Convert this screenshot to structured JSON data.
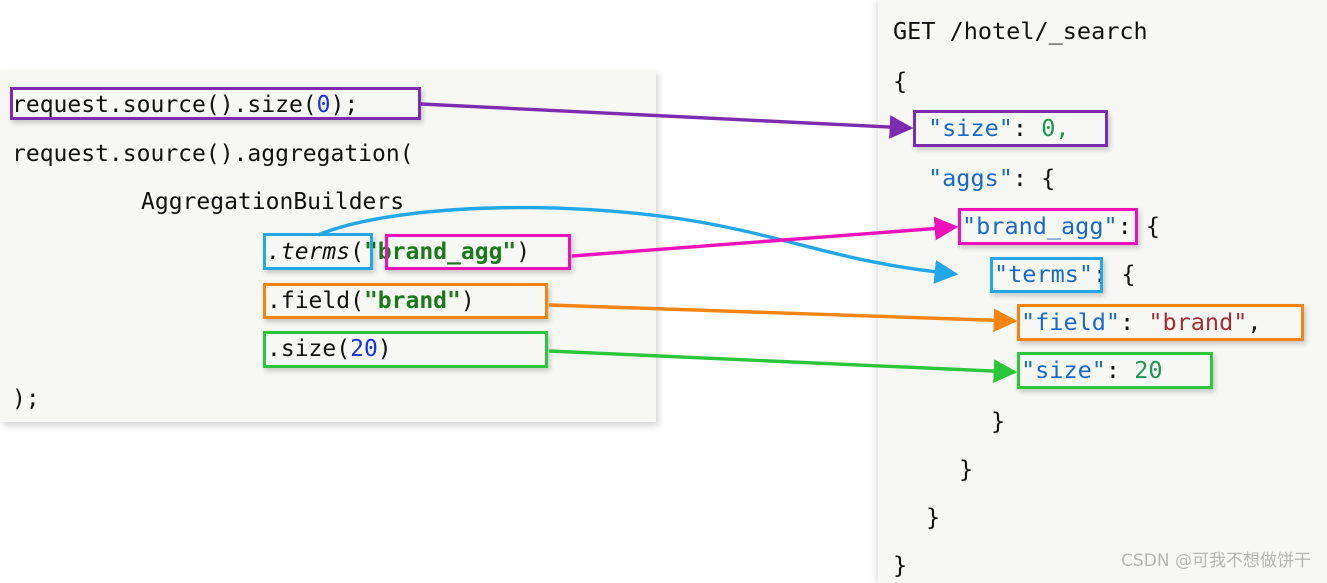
{
  "left_code": {
    "lines": [
      {
        "id": "l1",
        "text": "request.source().size(",
        "tail": ");",
        "num": "0"
      },
      {
        "id": "l2",
        "text": "request.source().aggregation("
      },
      {
        "id": "l3",
        "text": "AggregationBuilders"
      },
      {
        "id": "l4a",
        "text": ".terms"
      },
      {
        "id": "l4b",
        "text": "("
      },
      {
        "id": "l4c",
        "text": "\"brand_agg\""
      },
      {
        "id": "l4d",
        "text": ")"
      },
      {
        "id": "l5a",
        "text": ".field("
      },
      {
        "id": "l5b",
        "text": "\"brand\""
      },
      {
        "id": "l5c",
        "text": ")"
      },
      {
        "id": "l6a",
        "text": ".size("
      },
      {
        "id": "l6b",
        "text": "20"
      },
      {
        "id": "l6c",
        "text": ")"
      },
      {
        "id": "l7",
        "text": ");"
      }
    ]
  },
  "right_code": {
    "title": "GET /hotel/_search",
    "open_brace": "{",
    "size_key": "\"size\"",
    "size_sep": ": ",
    "size_val": "0,",
    "aggs_key": "\"aggs\"",
    "aggs_rest": ": {",
    "brand_agg_key": "\"brand_agg\"",
    "brand_agg_rest": ": {",
    "terms_key": "\"terms\"",
    "terms_rest": ": {",
    "field_key": "\"field\"",
    "field_sep": ": ",
    "field_val": "\"brand\"",
    "field_comma": ",",
    "size2_key": "\"size\"",
    "size2_sep": ": ",
    "size2_val": "20",
    "close1": "}",
    "close2": "}",
    "close3": "}",
    "close4": "}"
  },
  "watermark": {
    "text": "CSDN @可我不想做饼干"
  },
  "colors": {
    "purple": "#7d2cb0",
    "cyan": "#22a7e8",
    "magenta": "#ee11bb",
    "orange": "#f58410",
    "green": "#2cc63a",
    "panel_bg": "#f7f8f3",
    "json_key": "#1669c8",
    "json_string": "#a22c32",
    "json_number": "#1a9a4e",
    "java_string": "#1a7a1a",
    "java_number": "#1530f0"
  },
  "mappings": [
    {
      "id": "map-size",
      "from": "request.source().size(0);",
      "to": "\"size\": 0,",
      "color": "#7d2cb0"
    },
    {
      "id": "map-terms",
      "from": ".terms",
      "to": "\"terms\"",
      "color": "#22a7e8"
    },
    {
      "id": "map-brandagg",
      "from": "\"brand_agg\"",
      "to": "\"brand_agg\"",
      "color": "#ee11bb"
    },
    {
      "id": "map-field",
      "from": ".field(\"brand\")",
      "to": "\"field\": \"brand\",",
      "color": "#f58410"
    },
    {
      "id": "map-size20",
      "from": ".size(20)",
      "to": "\"size\": 20",
      "color": "#2cc63a"
    }
  ]
}
